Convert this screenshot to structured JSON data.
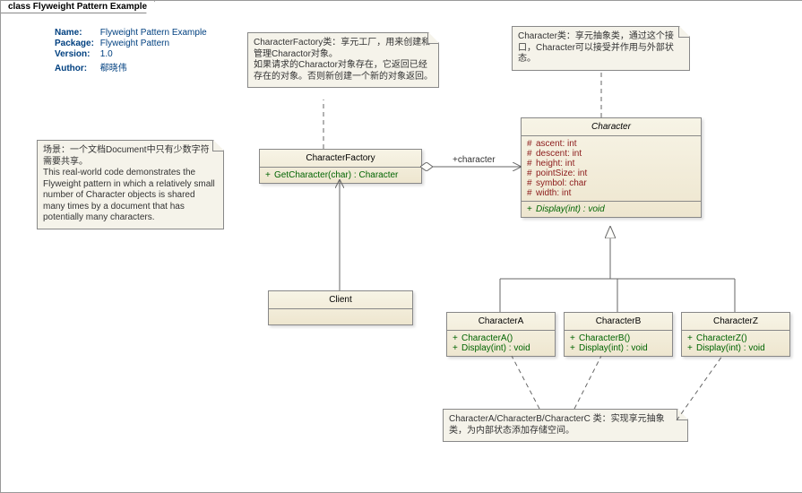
{
  "frame": {
    "title": "class Flyweight Pattern Example"
  },
  "meta": {
    "name_lbl": "Name:",
    "name_val": "Flyweight Pattern Example",
    "pkg_lbl": "Package:",
    "pkg_val": "Flyweight Pattern",
    "ver_lbl": "Version:",
    "ver_val": "1.0",
    "auth_lbl": "Author:",
    "auth_val": "郗晓伟"
  },
  "notes": {
    "scenario": "场景：一个文档Document中只有少数字符需要共享。\nThis real-world code demonstrates the Flyweight pattern in which a relatively small number of Character objects is shared many times by a document that has potentially many characters.",
    "factory": "CharacterFactory类：享元工厂，用来创建和管理Charactor对象。\n如果请求的Charactor对象存在，它返回已经存在的对象。否则新创建一个新的对象返回。",
    "character": "Character类：享元抽象类，通过这个接口，Character可以接受并作用与外部状态。",
    "concrete": "CharacterA/CharacterB/CharacterC 类：实现享元抽象类，为内部状态添加存储空间。"
  },
  "classes": {
    "factory": {
      "name": "CharacterFactory",
      "ops": [
        {
          "vis": "+",
          "sig": "GetCharacter(char) : Character"
        }
      ]
    },
    "client": {
      "name": "Client"
    },
    "character": {
      "name": "Character",
      "attrs": [
        {
          "vis": "#",
          "sig": "ascent: int"
        },
        {
          "vis": "#",
          "sig": "descent: int"
        },
        {
          "vis": "#",
          "sig": "height: int"
        },
        {
          "vis": "#",
          "sig": "pointSize: int"
        },
        {
          "vis": "#",
          "sig": "symbol: char"
        },
        {
          "vis": "#",
          "sig": "width: int"
        }
      ],
      "ops": [
        {
          "vis": "+",
          "sig": "Display(int) : void"
        }
      ]
    },
    "charA": {
      "name": "CharacterA",
      "ops": [
        {
          "vis": "+",
          "sig": "CharacterA()"
        },
        {
          "vis": "+",
          "sig": "Display(int) : void"
        }
      ]
    },
    "charB": {
      "name": "CharacterB",
      "ops": [
        {
          "vis": "+",
          "sig": "CharacterB()"
        },
        {
          "vis": "+",
          "sig": "Display(int) : void"
        }
      ]
    },
    "charZ": {
      "name": "CharacterZ",
      "ops": [
        {
          "vis": "+",
          "sig": "CharacterZ()"
        },
        {
          "vis": "+",
          "sig": "Display(int) : void"
        }
      ]
    }
  },
  "labels": {
    "assoc": "+character"
  }
}
